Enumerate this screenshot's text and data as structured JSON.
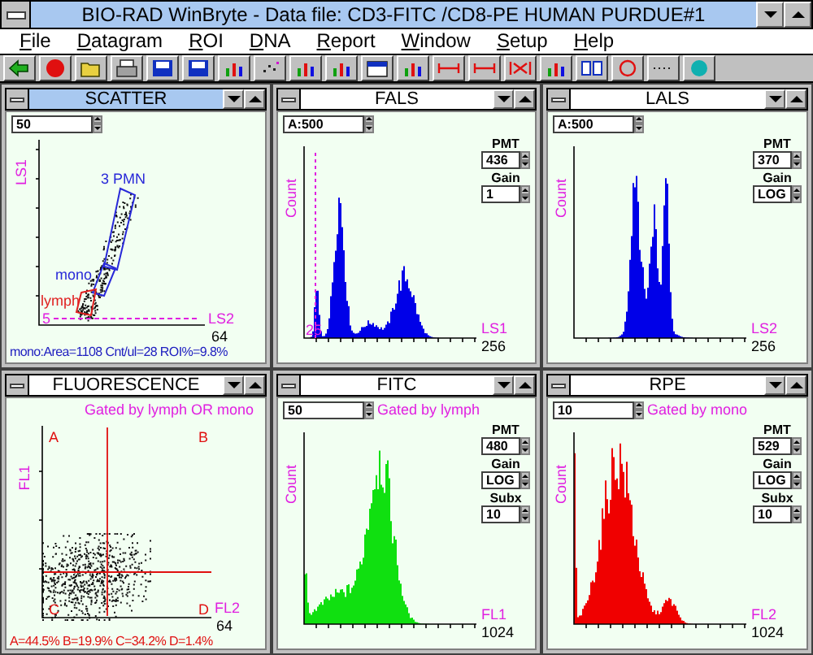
{
  "window": {
    "title": "BIO-RAD WinBryte - Data file: CD3-FITC /CD8-PE HUMAN PURDUE#1"
  },
  "menu": [
    "File",
    "Datagram",
    "ROI",
    "DNA",
    "Report",
    "Window",
    "Setup",
    "Help"
  ],
  "panels": [
    {
      "kind": "scatter",
      "title": "SCATTER",
      "active": true,
      "field": "50",
      "y_label": "LS1",
      "x_label": "LS2",
      "marker": "5",
      "x_max": "64",
      "regions": [
        {
          "label": "3 PMN",
          "color": "#2828d8"
        },
        {
          "label": "mono",
          "color": "#2828d8"
        },
        {
          "label": "lymph",
          "color": "#e02020"
        }
      ],
      "stats": "mono:Area=1108 Cnt/ul=28 ROI%=9.8%"
    },
    {
      "kind": "histogram",
      "title": "FALS",
      "active": false,
      "field": "A:500",
      "color": "#0000e8",
      "y_label": "Count",
      "x_label": "LS1",
      "marker": "25",
      "x_max": "256",
      "controls": [
        {
          "label": "PMT",
          "value": "436"
        },
        {
          "label": "Gain",
          "value": "1"
        }
      ]
    },
    {
      "kind": "histogram",
      "title": "LALS",
      "active": false,
      "field": "A:500",
      "color": "#0000e8",
      "y_label": "Count",
      "x_label": "LS2",
      "x_max": "256",
      "controls": [
        {
          "label": "PMT",
          "value": "370"
        },
        {
          "label": "Gain",
          "value": "LOG"
        }
      ]
    },
    {
      "kind": "quadrant",
      "title": "FLUORESCENCE",
      "active": false,
      "gate": "Gated by lymph OR mono",
      "quadrants": [
        "A",
        "B",
        "C",
        "D"
      ],
      "y_label": "FL1",
      "x_label": "FL2",
      "x_max": "64",
      "stats": "A=44.5% B=19.9% C=34.2% D=1.4%"
    },
    {
      "kind": "histogram",
      "title": "FITC",
      "active": false,
      "field": "50",
      "gate": "Gated by lymph",
      "color": "#10e010",
      "y_label": "Count",
      "x_label": "FL1",
      "x_max": "1024",
      "controls": [
        {
          "label": "PMT",
          "value": "480"
        },
        {
          "label": "Gain",
          "value": "LOG"
        },
        {
          "label": "Subx",
          "value": "10"
        }
      ]
    },
    {
      "kind": "histogram",
      "title": "RPE",
      "active": false,
      "field": "10",
      "gate": "Gated by mono",
      "color": "#f00000",
      "y_label": "Count",
      "x_label": "FL2",
      "x_max": "1024",
      "controls": [
        {
          "label": "PMT",
          "value": "529"
        },
        {
          "label": "Gain",
          "value": "LOG"
        },
        {
          "label": "Subx",
          "value": "10"
        }
      ]
    }
  ]
}
